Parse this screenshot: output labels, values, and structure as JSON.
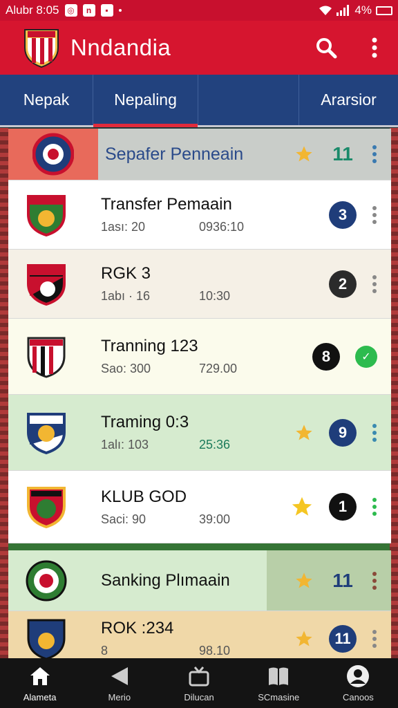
{
  "status": {
    "time": "Alubr 8:05",
    "battery": "4%",
    "icons": [
      "whatsapp-icon",
      "notification-icon",
      "message-icon"
    ]
  },
  "app": {
    "title": "Nndandia",
    "logo": "club-crest-logo"
  },
  "tabs": [
    {
      "label": "Nepak",
      "active": false
    },
    {
      "label": "Nepaling",
      "active": true
    },
    {
      "label": "",
      "active": false
    },
    {
      "label": "Ararsior",
      "active": false
    }
  ],
  "rows": [
    {
      "title": "Sepafer Penneain",
      "meta1": "",
      "meta2": "",
      "count": "11",
      "starred": true,
      "bg": "#c9cdc9",
      "highlight": "#e86a5b",
      "titleColor": "#2a4a8a",
      "badgeColor": "",
      "countColor": "#1a8a6a",
      "menuColor": "#3a7ab0"
    },
    {
      "title": "Transfer Pemaain",
      "meta1": "1ası: 20",
      "meta2": "0936:10",
      "count": "3",
      "starred": false,
      "bg": "#ffffff",
      "badgeColor": "#1f3d7a"
    },
    {
      "title": "RGK 3",
      "meta1": "1abı · 16",
      "meta2": "10:30",
      "count": "2",
      "starred": false,
      "bg": "#f5f0e6",
      "badgeColor": "#2b2b2b"
    },
    {
      "title": "Tranning 123",
      "meta1": "Sao: 300",
      "meta2": "729.00",
      "count": "8",
      "starred": false,
      "bg": "#fbfbec",
      "badgeColor": "#111111",
      "check": true
    },
    {
      "title": "Traming 0:3",
      "meta1": "1alı: 103",
      "meta2": "25:36",
      "count": "9",
      "starred": true,
      "bg": "#d6ebcf",
      "badgeColor": "#1f3d7a",
      "menuColor": "#3a8ab0"
    },
    {
      "title": "KLUB GOD",
      "meta1": "Saci: 90",
      "meta2": "39:00",
      "count": "1",
      "starred": true,
      "bg": "#ffffff",
      "badgeColor": "#111111",
      "menuColor": "#2dbb4e"
    },
    {
      "title": "Sanking Plımaain",
      "meta1": "",
      "meta2": "",
      "count": "11",
      "starred": true,
      "bg": "#d6ebcf",
      "highlight2": "#b8cfa8",
      "countColor": "#1f3d7a",
      "menuColor": "#8a4a3a"
    },
    {
      "title": "ROK :234",
      "meta1": "8",
      "meta2": "98.10",
      "count": "11",
      "starred": true,
      "bg": "#f0d8a8",
      "badgeColor": "#1f3d7a"
    }
  ],
  "nav": [
    {
      "label": "Alameta",
      "icon": "home-icon",
      "active": true
    },
    {
      "label": "Merio",
      "icon": "back-icon",
      "active": false
    },
    {
      "label": "Dilucan",
      "icon": "tv-icon",
      "active": false
    },
    {
      "label": "SCmasine",
      "icon": "book-icon",
      "active": false
    },
    {
      "label": "Canoos",
      "icon": "profile-icon",
      "active": false
    }
  ]
}
